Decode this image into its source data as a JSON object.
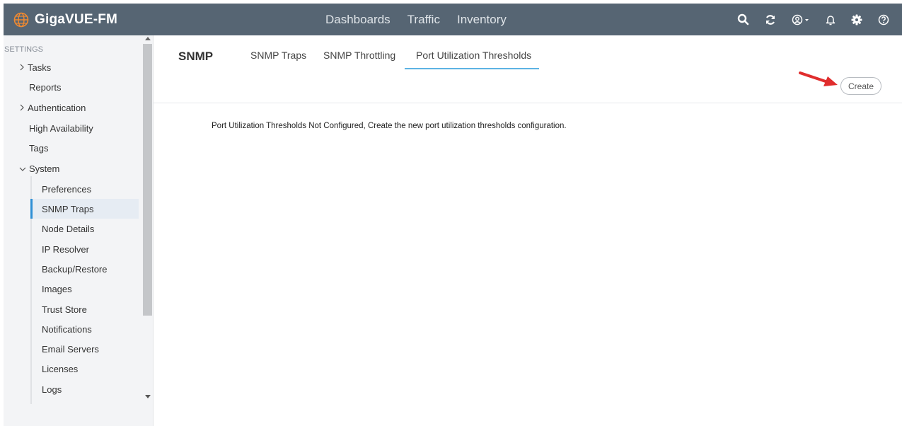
{
  "app": {
    "title": "GigaVUE-FM",
    "logo_icon": "globe-icon"
  },
  "nav": {
    "items": [
      "Dashboards",
      "Traffic",
      "Inventory"
    ]
  },
  "toolbar": {
    "icons": [
      "search-icon",
      "refresh-icon",
      "user-icon",
      "bell-icon",
      "gear-icon",
      "help-icon"
    ]
  },
  "sidebar": {
    "heading": "SETTINGS",
    "items": [
      {
        "label": "Tasks",
        "caret": ">"
      },
      {
        "label": "Reports",
        "caret": ""
      },
      {
        "label": "Authentication",
        "caret": ">"
      },
      {
        "label": "High Availability",
        "caret": ""
      },
      {
        "label": "Tags",
        "caret": ""
      },
      {
        "label": "System",
        "caret": "v"
      }
    ],
    "system_children": [
      "Preferences",
      "SNMP Traps",
      "Node Details",
      "IP Resolver",
      "Backup/Restore",
      "Images",
      "Trust Store",
      "Notifications",
      "Email Servers",
      "Licenses",
      "Logs"
    ],
    "active_child": "SNMP Traps"
  },
  "main": {
    "title": "SNMP",
    "tabs": [
      "SNMP Traps",
      "SNMP Throttling",
      "Port Utilization Thresholds"
    ],
    "active_tab": "Port Utilization Thresholds",
    "create_label": "Create",
    "message": "Port Utilization Thresholds Not Configured, Create the new port utilization thresholds configuration."
  },
  "colors": {
    "topbar": "#566573",
    "accent": "#5db3e4",
    "active_bar": "#2d8fd5",
    "arrow": "#e02d2d"
  }
}
